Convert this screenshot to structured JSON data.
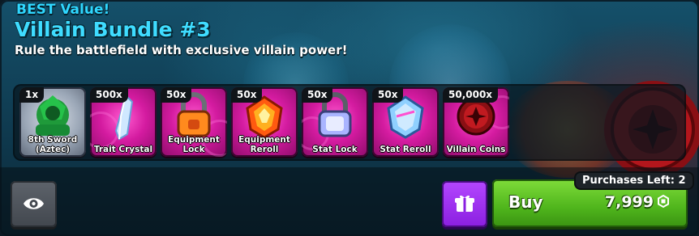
{
  "offer": {
    "badge": "BEST Value!",
    "title": "Villain Bundle #3",
    "subtitle": "Rule the battlefield with exclusive villain power!"
  },
  "items": [
    {
      "qty": "1x",
      "label_line1": "8th Sword",
      "label_line2": "(Aztec)",
      "icon": "sword-character-icon",
      "rarity_color": "#b8c2d0"
    },
    {
      "qty": "500x",
      "label_line1": "Trait Crystal",
      "label_line2": "",
      "icon": "crystal-icon",
      "rarity_color": "#e01fae"
    },
    {
      "qty": "50x",
      "label_line1": "Equipment",
      "label_line2": "Lock",
      "icon": "padlock-icon",
      "rarity_color": "#e01fae"
    },
    {
      "qty": "50x",
      "label_line1": "Equipment",
      "label_line2": "Reroll",
      "icon": "gem-icon",
      "rarity_color": "#e01fae"
    },
    {
      "qty": "50x",
      "label_line1": "Stat Lock",
      "label_line2": "",
      "icon": "padlock-icon",
      "rarity_color": "#e01fae"
    },
    {
      "qty": "50x",
      "label_line1": "Stat Reroll",
      "label_line2": "",
      "icon": "ice-gem-icon",
      "rarity_color": "#e01fae"
    },
    {
      "qty": "50,000x",
      "label_line1": "Villain Coins",
      "label_line2": "",
      "icon": "villain-coin-icon",
      "rarity_color": "#e01fae"
    }
  ],
  "actions": {
    "preview_icon": "eye-icon",
    "gift_icon": "gift-icon",
    "buy_label": "Buy",
    "price": "7,999",
    "currency_icon": "robux-icon",
    "purchases_left": "Purchases Left: 2"
  },
  "colors": {
    "title": "#3fdcff",
    "buy_button": "#5cc323",
    "gift_button": "#9a2ff0"
  }
}
